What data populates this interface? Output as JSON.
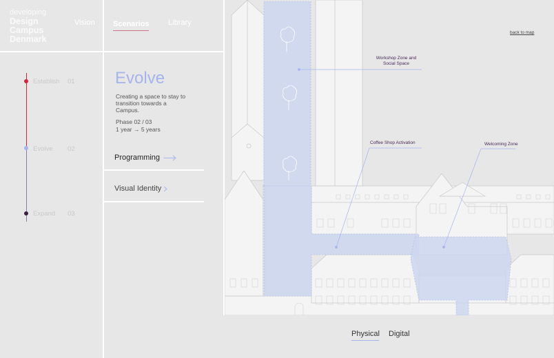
{
  "logo": {
    "line1": "developing",
    "line2": "Design",
    "line3": "Campus",
    "line4": "Denmark"
  },
  "nav": {
    "vision": "Vision",
    "scenarios": "Scenarios",
    "library": "Library"
  },
  "timeline": [
    {
      "label": "Establish",
      "number": "01",
      "color": "#d8223a"
    },
    {
      "label": "Evolve",
      "number": "02",
      "color": "#a6b4ec"
    },
    {
      "label": "Expand",
      "number": "03",
      "color": "#3b1f3f"
    }
  ],
  "scenario": {
    "title": "Evolve",
    "description": "Creating a space to stay to transition towards a Campus.",
    "phase": "Phase 02 / 03",
    "duration": "1 year → 5 years"
  },
  "menu": {
    "programming": "Programming",
    "visual_identity": "Visual Identity"
  },
  "map": {
    "back_link": "back to map",
    "labels": {
      "workshop_line1": "Workshop Zone and",
      "workshop_line2": "Social Space",
      "coffee": "Coffee Shop Activation",
      "welcoming": "Welcoming Zone"
    }
  },
  "bottom_tabs": {
    "physical": "Physical",
    "digital": "Digital"
  },
  "colors": {
    "accent": "#a6b4ec",
    "establish": "#d8223a",
    "expand": "#3b1f3f",
    "label": "#4a2a55"
  }
}
